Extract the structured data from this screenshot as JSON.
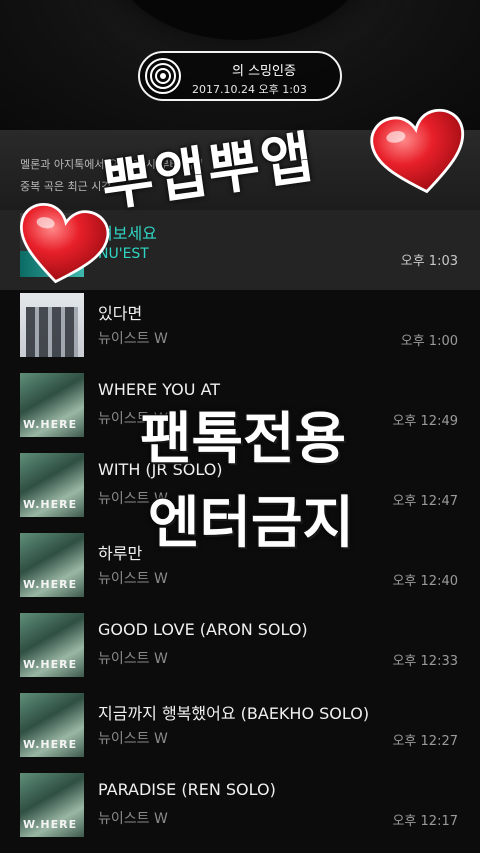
{
  "header": {
    "title": "의 스밍인증",
    "date": "2017.10.24 오후 1:03"
  },
  "notice": {
    "line1": "멜론과 아지톡에서 오늘 00시 부터 재생",
    "line2": "중복 곡은 최근 시간"
  },
  "songs": [
    {
      "title": "여보세요",
      "artist": "NU'EST",
      "time": "오후 1:03",
      "active": true
    },
    {
      "title": "있다면",
      "artist": "뉴이스트 W",
      "time": "오후 1:00"
    },
    {
      "title": "WHERE YOU AT",
      "artist": "뉴이스트 W",
      "time": "오후 12:49"
    },
    {
      "title": "WITH (JR SOLO)",
      "artist": "뉴이스트 W",
      "time": "오후 12:47"
    },
    {
      "title": "하루만",
      "artist": "뉴이스트 W",
      "time": "오후 12:40"
    },
    {
      "title": "GOOD LOVE (ARON SOLO)",
      "artist": "뉴이스트 W",
      "time": "오후 12:33"
    },
    {
      "title": "지금까지 행복했어요 (BAEKHO SOLO)",
      "artist": "뉴이스트 W",
      "time": "오후 12:27"
    },
    {
      "title": "PARADISE (REN SOLO)",
      "artist": "뉴이스트 W",
      "time": "오후 12:17"
    }
  ],
  "album_label": "W.HERE",
  "overlay": {
    "top": "뿌앱뿌앱",
    "mid1": "팬톡전용",
    "mid2": "엔터금지"
  },
  "colors": {
    "accent": "#2fd6c3",
    "heart": "#e8202a"
  },
  "icons": {
    "pill": "record-disc-icon",
    "stickers": "heart-icon"
  }
}
